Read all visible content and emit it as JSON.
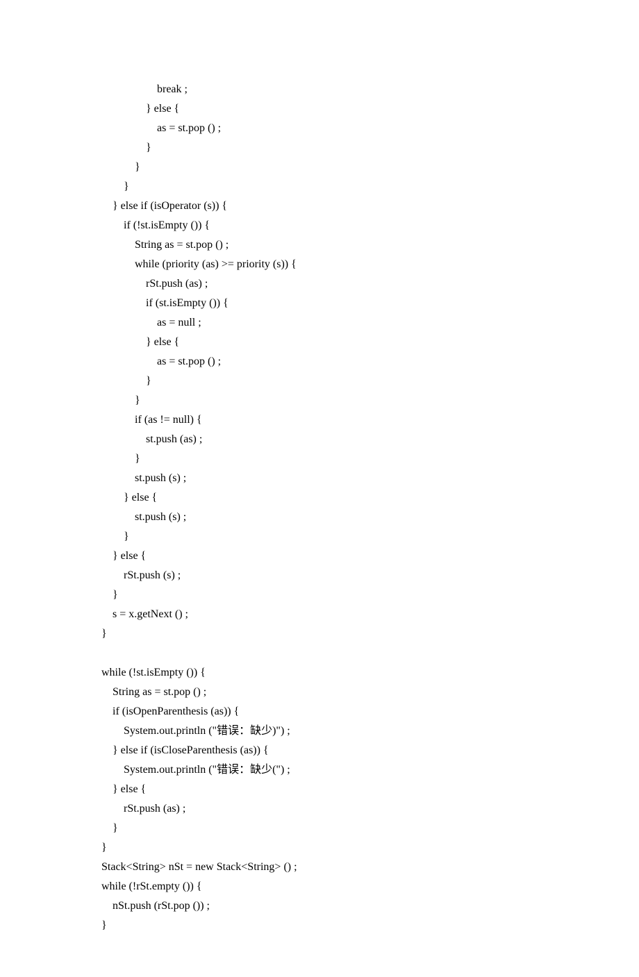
{
  "lines": [
    "                        break ;",
    "                    } else {",
    "                        as = st.pop () ;",
    "                    }",
    "                }",
    "            }",
    "        } else if (isOperator (s)) {",
    "            if (!st.isEmpty ()) {",
    "                String as = st.pop () ;",
    "                while (priority (as) >= priority (s)) {",
    "                    rSt.push (as) ;",
    "                    if (st.isEmpty ()) {",
    "                        as = null ;",
    "                    } else {",
    "                        as = st.pop () ;",
    "                    }",
    "                }",
    "                if (as != null) {",
    "                    st.push (as) ;",
    "                }",
    "                st.push (s) ;",
    "            } else {",
    "                st.push (s) ;",
    "            }",
    "        } else {",
    "            rSt.push (s) ;",
    "        }",
    "        s = x.getNext () ;",
    "    }",
    "",
    "    while (!st.isEmpty ()) {",
    "        String as = st.pop () ;",
    "        if (isOpenParenthesis (as)) {",
    "            System.out.println (\"错误：缺少)\") ;",
    "        } else if (isCloseParenthesis (as)) {",
    "            System.out.println (\"错误：缺少(\") ;",
    "        } else {",
    "            rSt.push (as) ;",
    "        }",
    "    }",
    "    Stack<String> nSt = new Stack<String> () ;",
    "    while (!rSt.empty ()) {",
    "        nSt.push (rSt.pop ()) ;",
    "    }"
  ]
}
